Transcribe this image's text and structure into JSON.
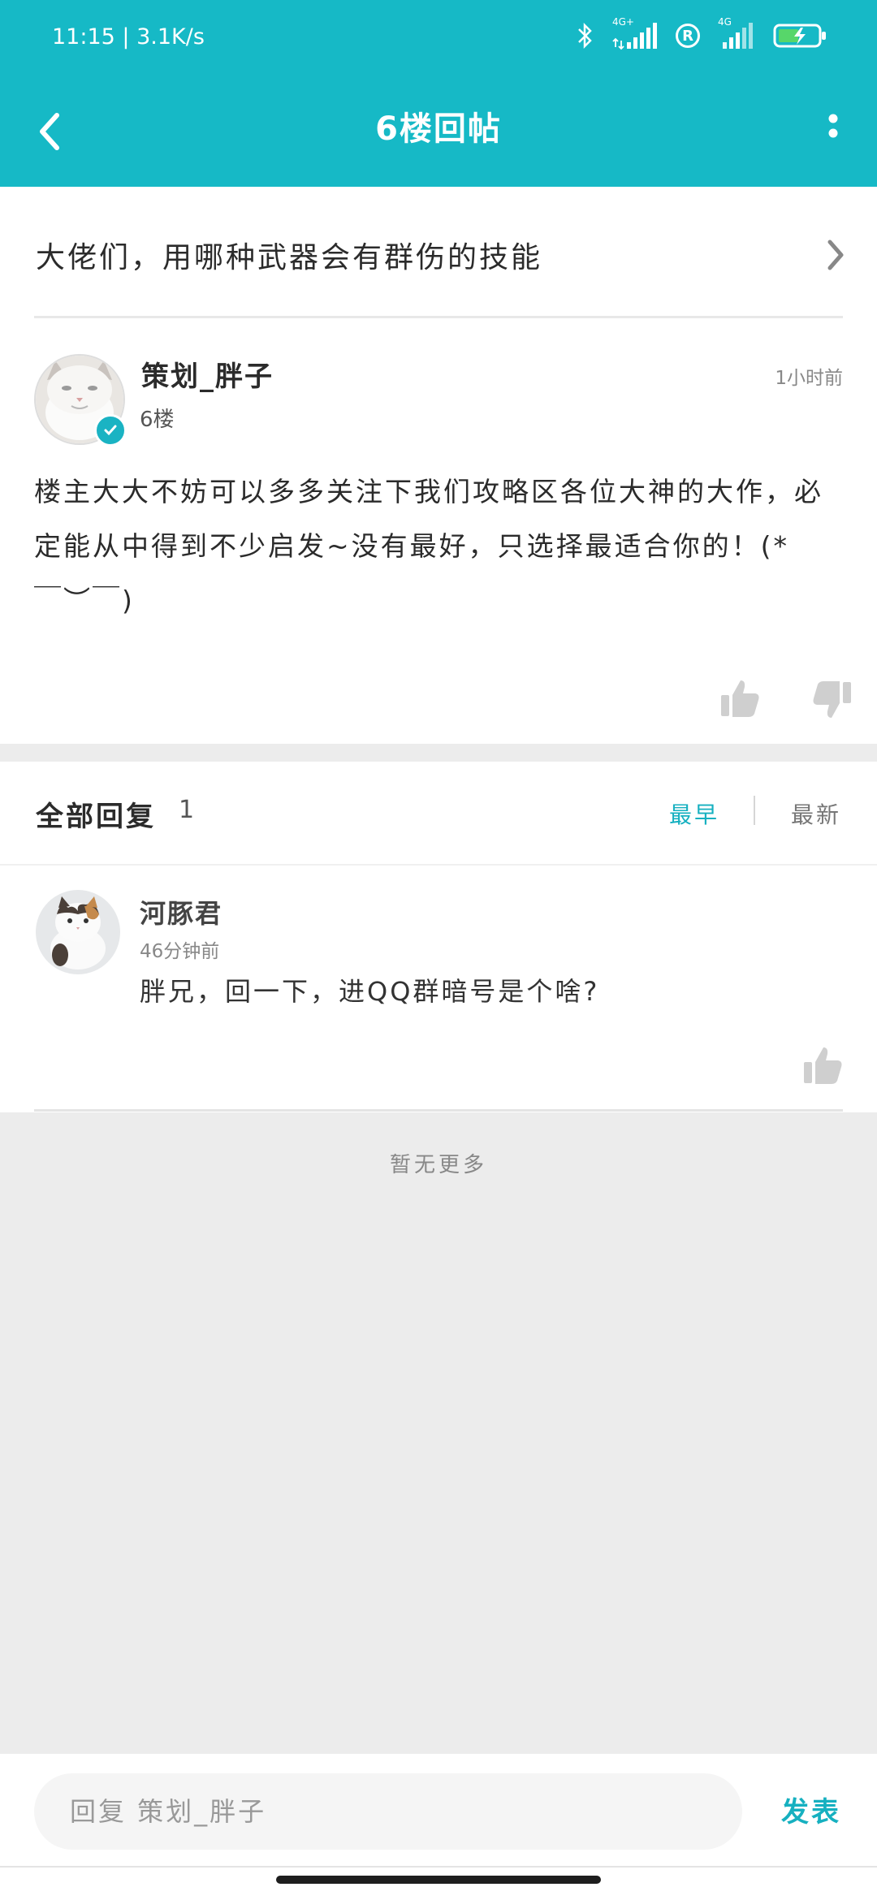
{
  "status_bar": {
    "time_speed": "11:15 | 3.1K/s",
    "sim1_label": "4G+",
    "sim2_label": "4G",
    "roaming_badge": "R"
  },
  "header": {
    "title": "6楼回帖"
  },
  "topic": {
    "title": "大佬们，用哪种武器会有群伤的技能"
  },
  "post": {
    "author": "策划_胖子",
    "floor": "6楼",
    "time": "1小时前",
    "content": "楼主大大不妨可以多多关注下我们攻略区各位大神的大作，必定能从中得到不少启发~没有最好，只选择最适合你的！(*￣︶￣)"
  },
  "replies": {
    "label": "全部回复",
    "count": "1",
    "sort_earliest": "最早",
    "sort_newest": "最新",
    "items": [
      {
        "author": "河豚君",
        "time": "46分钟前",
        "text": "胖兄，回一下，进QQ群暗号是个啥?"
      }
    ],
    "no_more": "暂无更多"
  },
  "bottom_bar": {
    "placeholder": "回复 策划_胖子",
    "send_label": "发表"
  },
  "colors": {
    "accent": "#16b9c6",
    "background": "#ececec"
  },
  "icons": {
    "back": "chevron-left-icon",
    "more": "more-vertical-icon",
    "topic_arrow": "chevron-right-icon",
    "like": "thumbs-up-icon",
    "dislike": "thumbs-down-icon"
  }
}
